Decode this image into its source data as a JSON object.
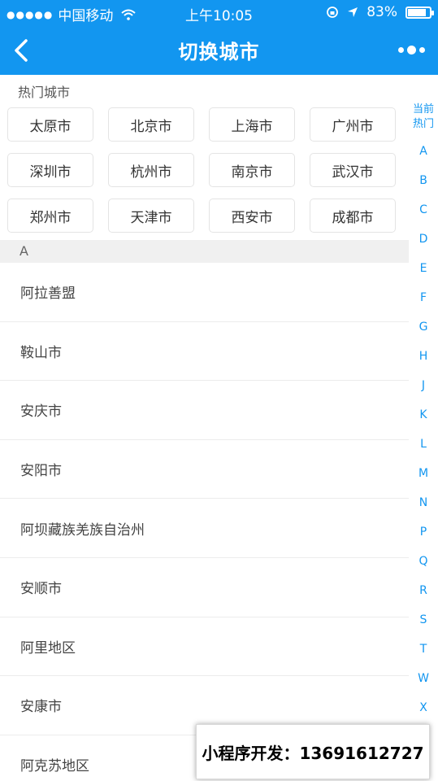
{
  "status": {
    "carrier": "中国移动",
    "time": "上午10:05",
    "battery": "83%",
    "battery_level": 0.83
  },
  "navbar": {
    "title": "切换城市"
  },
  "hot": {
    "label": "热门城市",
    "cities": [
      "太原市",
      "北京市",
      "上海市",
      "广州市",
      "深圳市",
      "杭州市",
      "南京市",
      "武汉市",
      "郑州市",
      "天津市",
      "西安市",
      "成都市"
    ]
  },
  "section": {
    "letter": "A",
    "cities": [
      "阿拉善盟",
      "鞍山市",
      "安庆市",
      "安阳市",
      "阿坝藏族羌族自治州",
      "安顺市",
      "阿里地区",
      "安康市",
      "阿克苏地区"
    ]
  },
  "index": {
    "current_line1": "当前",
    "current_line2": "热门",
    "letters": [
      "A",
      "B",
      "C",
      "D",
      "E",
      "F",
      "G",
      "H",
      "J",
      "K",
      "L",
      "M",
      "N",
      "P",
      "Q",
      "R",
      "S",
      "T",
      "W",
      "X"
    ]
  },
  "promo": {
    "text": "小程序开发：13691612727"
  },
  "colors": {
    "primary": "#1296f0",
    "section_bg": "#f0f0f0"
  },
  "icons": [
    "signal-dots-icon",
    "wifi-icon",
    "rotation-lock-icon",
    "location-arrow-icon",
    "battery-icon",
    "back-chevron-icon",
    "more-dots-icon"
  ]
}
